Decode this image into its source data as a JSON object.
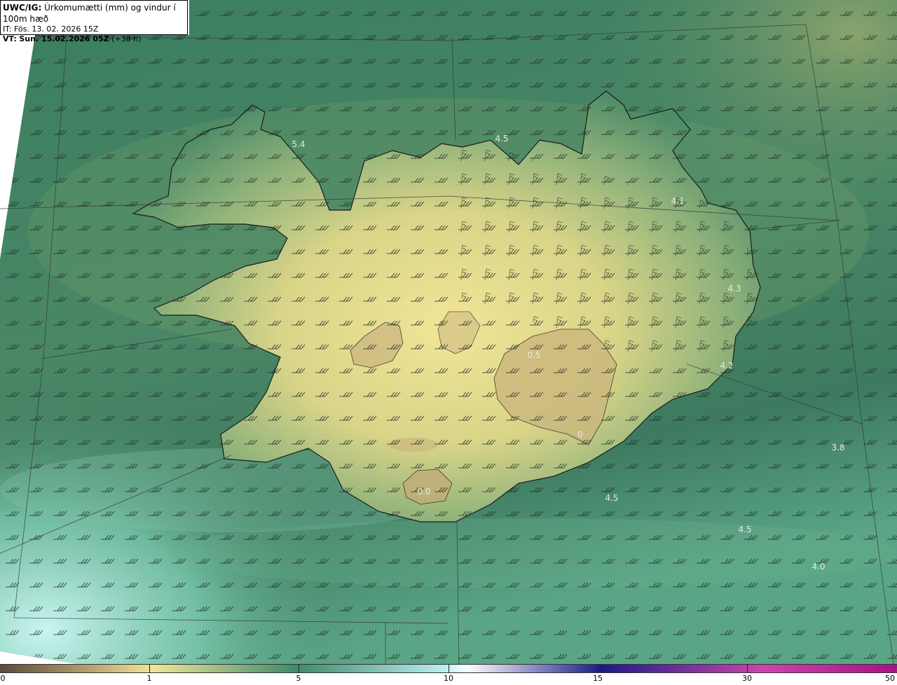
{
  "header": {
    "model": "UWC/IG:",
    "field": "Úrkomumætti (mm) og vindur í 100m hæð",
    "it_label": "IT:",
    "it_value": "Fös. 13. 02. 2026 15Z",
    "vt_label": "VT:",
    "vt_value": "Sun. 15.02.2026 05Z",
    "vt_lead": "(+38 h)"
  },
  "value_labels": [
    {
      "text": "5.4"
    },
    {
      "text": "4.5"
    },
    {
      "text": "4.1"
    },
    {
      "text": "4.3"
    },
    {
      "text": "4.2"
    },
    {
      "text": "3.8"
    },
    {
      "text": "4.5"
    },
    {
      "text": "4.5"
    },
    {
      "text": "4.0"
    },
    {
      "text": "0.5"
    },
    {
      "text": "0"
    },
    {
      "text": "0.0"
    }
  ],
  "colorbar": {
    "ticks": [
      "0",
      "1",
      "5",
      "10",
      "15",
      "30",
      "50"
    ],
    "colors": [
      "#5a4a3a",
      "#b8a070",
      "#f0e69a",
      "#3f8a6a",
      "#bff0f5",
      "#ffffff",
      "#1a1a8a",
      "#cc44aa",
      "#aa1188"
    ]
  },
  "colors": {
    "sea_dark": "#2f7256",
    "sea_mid": "#4f8c68",
    "land_light": "#e6dc93",
    "highland": "#b4a070",
    "cyan": "#bff0ee"
  }
}
